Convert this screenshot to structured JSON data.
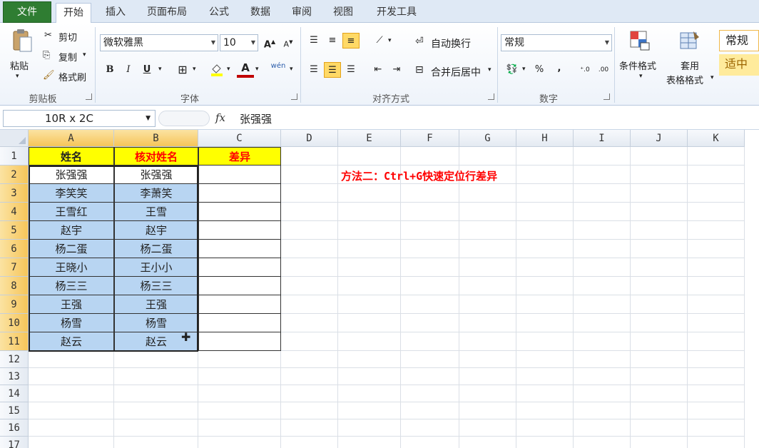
{
  "tabs": {
    "file": "文件",
    "items": [
      "开始",
      "插入",
      "页面布局",
      "公式",
      "数据",
      "审阅",
      "视图",
      "开发工具"
    ]
  },
  "ribbon": {
    "clipboard": {
      "paste": "粘贴",
      "cut": "剪切",
      "copy": "复制",
      "format_painter": "格式刷",
      "label": "剪贴板"
    },
    "font": {
      "name": "微软雅黑",
      "size": "10",
      "label": "字体",
      "bold": "B",
      "italic": "I",
      "underline": "U",
      "grow": "A",
      "shrink": "A",
      "wen": "wén",
      "font_color": "A"
    },
    "alignment": {
      "wrap": "自动换行",
      "merge": "合并后居中",
      "label": "对齐方式"
    },
    "number": {
      "format": "常规",
      "percent": "%",
      "comma": ",",
      "label": "数字"
    },
    "styles": {
      "conditional": "条件格式",
      "table_format_1": "套用",
      "table_format_2": "表格格式",
      "cell_style_normal": "常规",
      "cell_style_fit": "适中"
    }
  },
  "formula_bar": {
    "name_box": "10R x 2C",
    "fx": "fx",
    "content": "张强强"
  },
  "grid": {
    "columns": [
      "A",
      "B",
      "C",
      "D",
      "E",
      "F",
      "G",
      "H",
      "I",
      "J",
      "K"
    ],
    "rows": [
      "1",
      "2",
      "3",
      "4",
      "5",
      "6",
      "7",
      "8",
      "9",
      "10",
      "11",
      "12",
      "13",
      "14",
      "15",
      "16",
      "17"
    ],
    "headers": [
      "姓名",
      "核对姓名",
      "差异"
    ],
    "col_a": [
      "张强强",
      "李笑笑",
      "王雪红",
      "赵宇",
      "杨二蛋",
      "王晓小",
      "杨三三",
      "王强",
      "杨雪",
      "赵云"
    ],
    "col_b": [
      "张强强",
      "李萧笑",
      "王雪",
      "赵宇",
      "杨二蛋",
      "王小小",
      "杨三三",
      "王强",
      "杨雪",
      "赵云"
    ],
    "note": "方法二：Ctrl+G快速定位行差异"
  },
  "colors": {
    "header_fill": "#ffff00",
    "selection_fill": "#b8d5f2",
    "accent_red": "#ff0000",
    "file_tab": "#2f7d32"
  }
}
